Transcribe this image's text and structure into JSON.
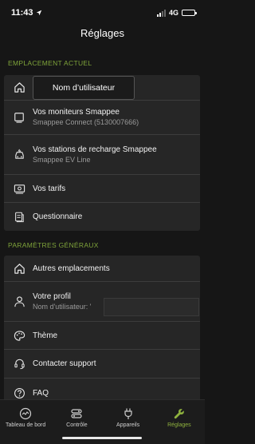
{
  "status_bar": {
    "time": "11:43",
    "network": "4G"
  },
  "nav": {
    "title": "Réglages"
  },
  "sections": {
    "current": {
      "header": "EMPLACEMENT ACTUEL",
      "items": [
        {
          "title": "",
          "subtitle": "",
          "icon": "home-icon"
        },
        {
          "title": "Vos moniteurs Smappee",
          "subtitle": "Smappee Connect (5130007666)",
          "icon": "monitor-icon"
        },
        {
          "title": "Vos stations de recharge Smappee",
          "subtitle": "Smappee EV Line",
          "icon": "ev-charger-icon"
        },
        {
          "title": "Vos tarifs",
          "subtitle": "",
          "icon": "tariff-icon"
        },
        {
          "title": "Questionnaire",
          "subtitle": "",
          "icon": "questionnaire-icon"
        }
      ]
    },
    "general": {
      "header": "PARAMÈTRES GÉNÉRAUX",
      "items": [
        {
          "title": "Autres emplacements",
          "subtitle": "",
          "icon": "home-icon"
        },
        {
          "title": "Votre profil",
          "subtitle": "Nom d'utilisateur: '",
          "icon": "profile-icon"
        },
        {
          "title": "Thème",
          "subtitle": "",
          "icon": "palette-icon"
        },
        {
          "title": "Contacter support",
          "subtitle": "",
          "icon": "headset-icon"
        },
        {
          "title": "FAQ",
          "subtitle": "",
          "icon": "help-icon"
        }
      ]
    }
  },
  "tooltip": {
    "text": "Nom d’utilisateur"
  },
  "tabs": [
    {
      "label": "Tableau de bord",
      "icon": "dashboard-icon",
      "active": false
    },
    {
      "label": "Contrôle",
      "icon": "control-icon",
      "active": false
    },
    {
      "label": "Appareils",
      "icon": "plug-icon",
      "active": false
    },
    {
      "label": "Réglages",
      "icon": "wrench-icon",
      "active": true
    }
  ],
  "colors": {
    "accent": "#8fb23e",
    "background": "#161616",
    "card": "#262626"
  }
}
